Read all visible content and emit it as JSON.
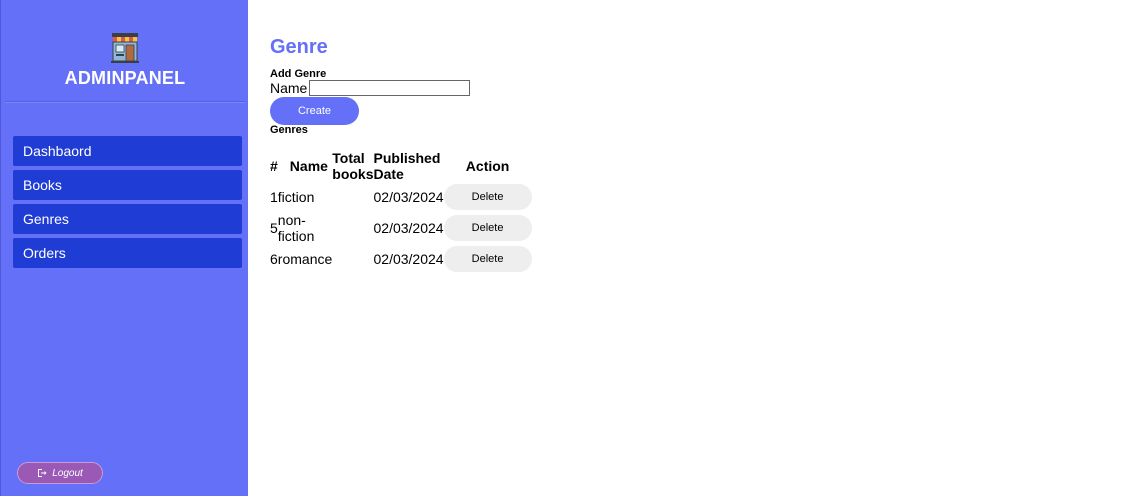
{
  "sidebar": {
    "brand": "ADMINPANEL",
    "logo_icon": "storefront-icon",
    "nav_items": [
      {
        "label": "Dashbaord"
      },
      {
        "label": "Books"
      },
      {
        "label": "Genres"
      },
      {
        "label": "Orders"
      }
    ],
    "logout_label": "Logout",
    "logout_icon": "sign-out-icon"
  },
  "main": {
    "title": "Genre",
    "form": {
      "heading": "Add Genre",
      "name_label": "Name",
      "name_value": "",
      "create_label": "Create"
    },
    "list_heading": "Genres",
    "table": {
      "headers": {
        "id": "#",
        "name": "Name",
        "total": "Total books",
        "date": "Published Date",
        "action": "Action"
      },
      "rows": [
        {
          "id": "1",
          "name": "fiction",
          "total": "",
          "date": "02/03/2024",
          "action": "Delete"
        },
        {
          "id": "5",
          "name": "non-fiction",
          "total": "",
          "date": "02/03/2024",
          "action": "Delete"
        },
        {
          "id": "6",
          "name": "romance",
          "total": "",
          "date": "02/03/2024",
          "action": "Delete"
        }
      ]
    }
  },
  "colors": {
    "accent": "#6470f7",
    "nav_item": "#1f3cd4",
    "logout": "#9b59b6",
    "delete_bg": "#eeeeee"
  }
}
